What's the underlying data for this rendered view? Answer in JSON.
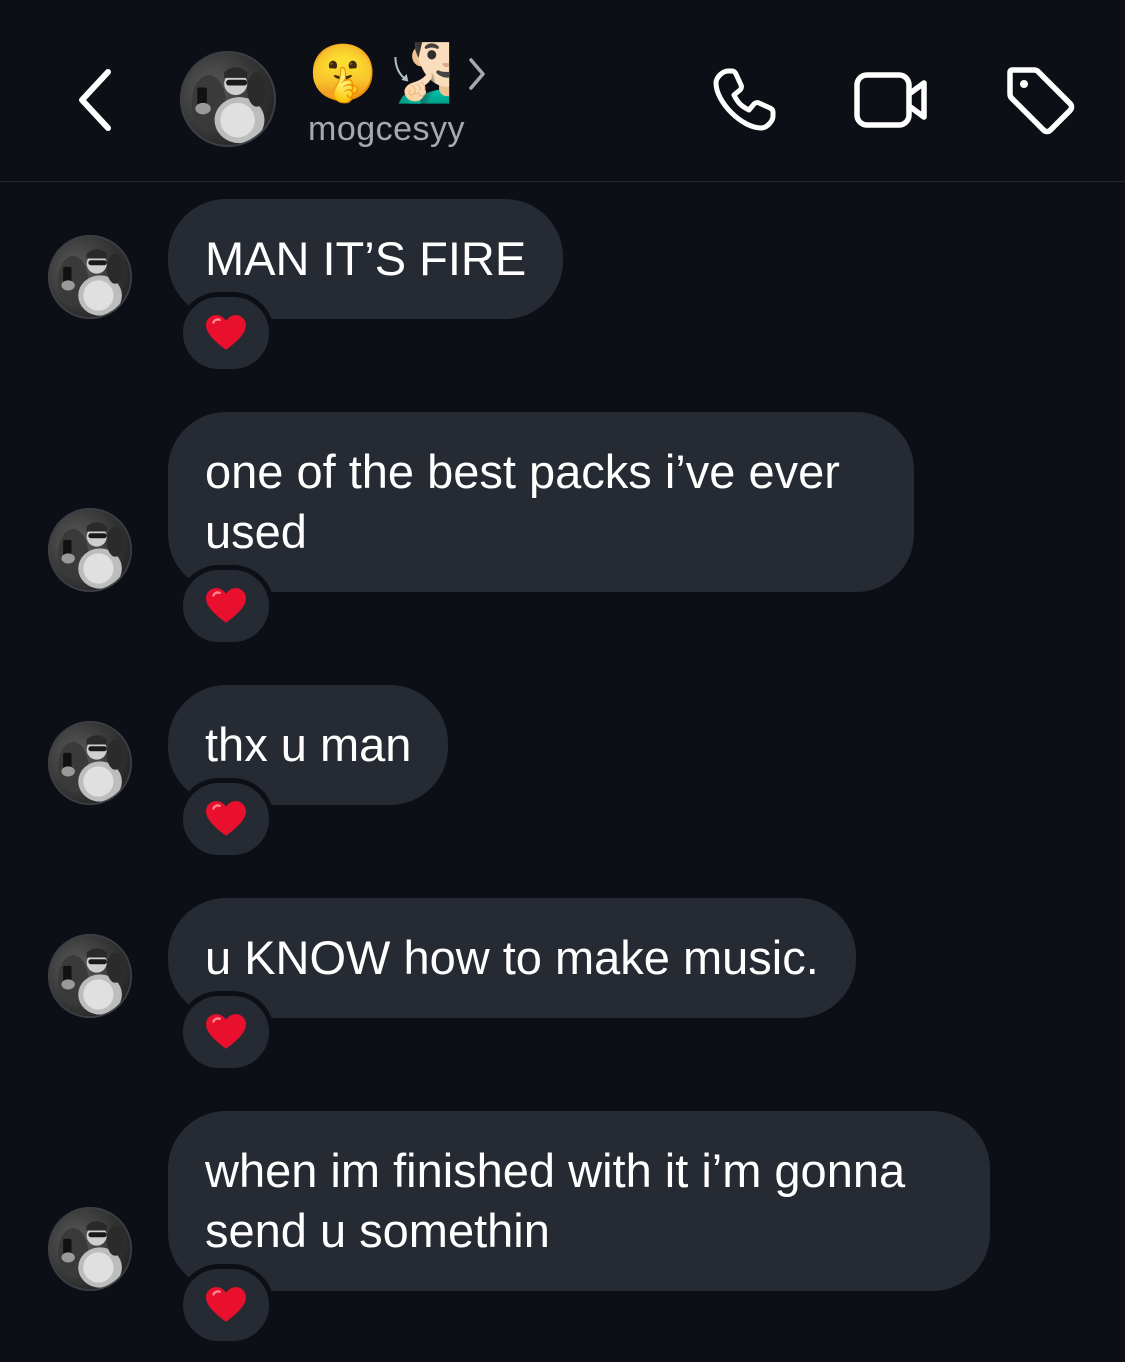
{
  "header": {
    "title_emojis": [
      "🤫",
      "🧏🏻‍♂️"
    ],
    "username": "mogcesyy",
    "icons": {
      "back": "chevron-left-icon",
      "call": "phone-icon",
      "video": "video-camera-icon",
      "tag": "tag-icon",
      "details": "chevron-right-icon"
    }
  },
  "colors": {
    "background": "#0c1016",
    "bubble": "#262a32",
    "subtext": "#a6a9ae",
    "heart": "#e8102c"
  },
  "messages": [
    {
      "text": "MAN IT’S FIRE",
      "reaction": "❤️"
    },
    {
      "text": "one of the best packs i’ve ever\nused",
      "reaction": "❤️"
    },
    {
      "text": "thx u man",
      "reaction": "❤️"
    },
    {
      "text": "u KNOW how to make music.",
      "reaction": "❤️"
    },
    {
      "text": "when im finished with it i’m gonna\nsend u somethin",
      "reaction": "❤️"
    }
  ]
}
